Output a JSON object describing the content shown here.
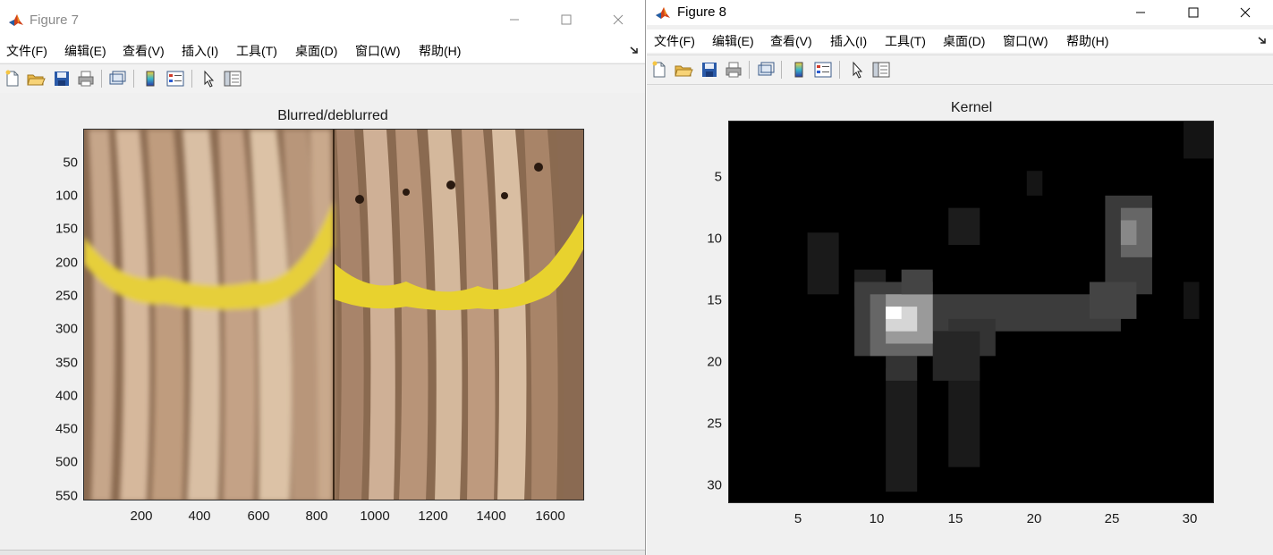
{
  "figure7": {
    "title": "Figure 7",
    "menus": [
      "文件(F)",
      "编辑(E)",
      "查看(V)",
      "插入(I)",
      "工具(T)",
      "桌面(D)",
      "窗口(W)",
      "帮助(H)"
    ],
    "axes_title": "Blurred/deblurred",
    "yticks": [
      "50",
      "100",
      "150",
      "200",
      "250",
      "300",
      "350",
      "400",
      "450",
      "500",
      "550"
    ],
    "xticks": [
      "200",
      "400",
      "600",
      "800",
      "1000",
      "1200",
      "1400",
      "1600"
    ],
    "image": "blurred and deblurred photo of dried fish tied with yellow string, side by side"
  },
  "figure8": {
    "title": "Figure 8",
    "menus": [
      "文件(F)",
      "编辑(E)",
      "查看(V)",
      "插入(I)",
      "工具(T)",
      "桌面(D)",
      "窗口(W)",
      "帮助(H)"
    ],
    "axes_title": "Kernel",
    "yticks": [
      "5",
      "10",
      "15",
      "20",
      "25",
      "30"
    ],
    "xticks": [
      "5",
      "10",
      "15",
      "20",
      "25",
      "30"
    ],
    "image": "grayscale kernel image, 31 by 31"
  },
  "toolbar_icons": [
    "new-figure-icon",
    "open-file-icon",
    "save-icon",
    "print-icon",
    "link-plot-icon",
    "colorbar-icon",
    "legend-icon",
    "edit-plot-icon",
    "property-inspector-icon"
  ],
  "colors": {
    "window_bg": "#f0f0f0",
    "titlebar_bg": "#ffffff",
    "axes_border": "#2a2a2a",
    "kernel_bg": "#000000"
  }
}
